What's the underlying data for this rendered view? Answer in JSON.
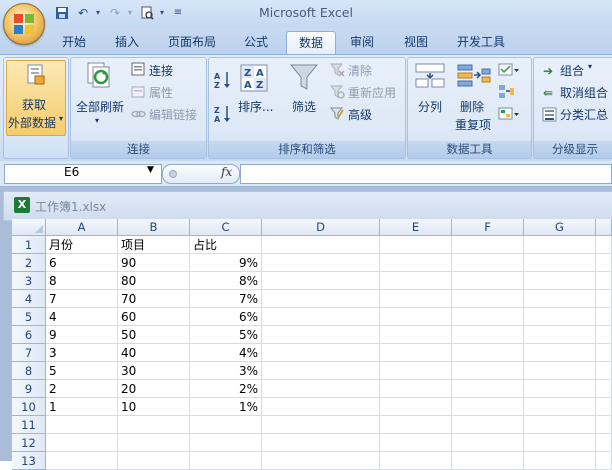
{
  "app": {
    "title": "Microsoft Excel"
  },
  "tabs": [
    "开始",
    "插入",
    "页面布局",
    "公式",
    "数据",
    "审阅",
    "视图",
    "开发工具"
  ],
  "active_tab": "数据",
  "ribbon": {
    "get_external": {
      "line1": "获取",
      "line2": "外部数据"
    },
    "connections": {
      "refresh_all": "全部刷新",
      "connect": "连接",
      "properties": "属性",
      "edit_links": "编辑链接",
      "label": "连接"
    },
    "sort_filter": {
      "sort": "排序...",
      "filter": "筛选",
      "clear": "清除",
      "reapply": "重新应用",
      "advanced": "高级",
      "label": "排序和筛选"
    },
    "data_tools": {
      "split": "分列",
      "remove_dup_1": "删除",
      "remove_dup_2": "重复项",
      "label": "数据工具"
    },
    "outline": {
      "group": "组合",
      "ungroup": "取消组合",
      "subtotal": "分类汇总",
      "label": "分级显示"
    }
  },
  "formula_bar": {
    "name_box": "E6",
    "fx": "fx",
    "formula": ""
  },
  "workbook": {
    "title": "工作簿1.xlsx"
  },
  "sheet": {
    "columns": [
      "A",
      "B",
      "C",
      "D",
      "E",
      "F",
      "G"
    ],
    "row_numbers": [
      "1",
      "2",
      "3",
      "4",
      "5",
      "6",
      "7",
      "8",
      "9",
      "10",
      "11",
      "12",
      "13"
    ],
    "rows": [
      [
        "月份",
        "项目",
        "占比"
      ],
      [
        "6",
        "90",
        "9%"
      ],
      [
        "8",
        "80",
        "8%"
      ],
      [
        "7",
        "70",
        "7%"
      ],
      [
        "4",
        "60",
        "6%"
      ],
      [
        "9",
        "50",
        "5%"
      ],
      [
        "3",
        "40",
        "4%"
      ],
      [
        "5",
        "30",
        "3%"
      ],
      [
        "2",
        "20",
        "2%"
      ],
      [
        "1",
        "10",
        "1%"
      ]
    ]
  }
}
